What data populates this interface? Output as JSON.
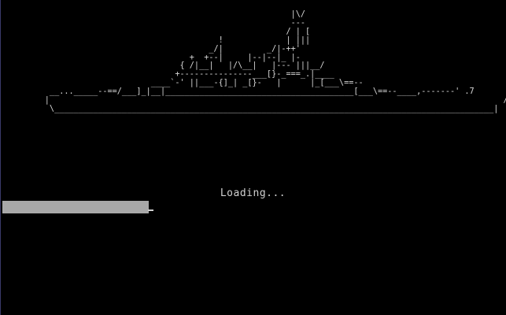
{
  "ship_art": [
    "                                                         |\\/",
    "                                                         ---",
    "                                                        / | [",
    "                                          !             | |||",
    "                                        _/|         _/|-++'",
    "                                    +  +--|     |--|--|_ |-",
    "                                  { /|__|   |/\\__|   |--- |||__/",
    "                                 +---------------___[}-_===_.|____",
    "                            ____`-' ||___-{]_| _[}-   |      |_[___\\==--",
    "       __..._____--==/___]_|__|_______________________________________[___\\==--____,-------' .7",
    "      |                                                                                              /",
    "       \\___________________________________________________________________________________________|"
  ],
  "side_glyph": "<>",
  "loading_label": "Loading...",
  "progress": {
    "fraction": 0.3
  }
}
